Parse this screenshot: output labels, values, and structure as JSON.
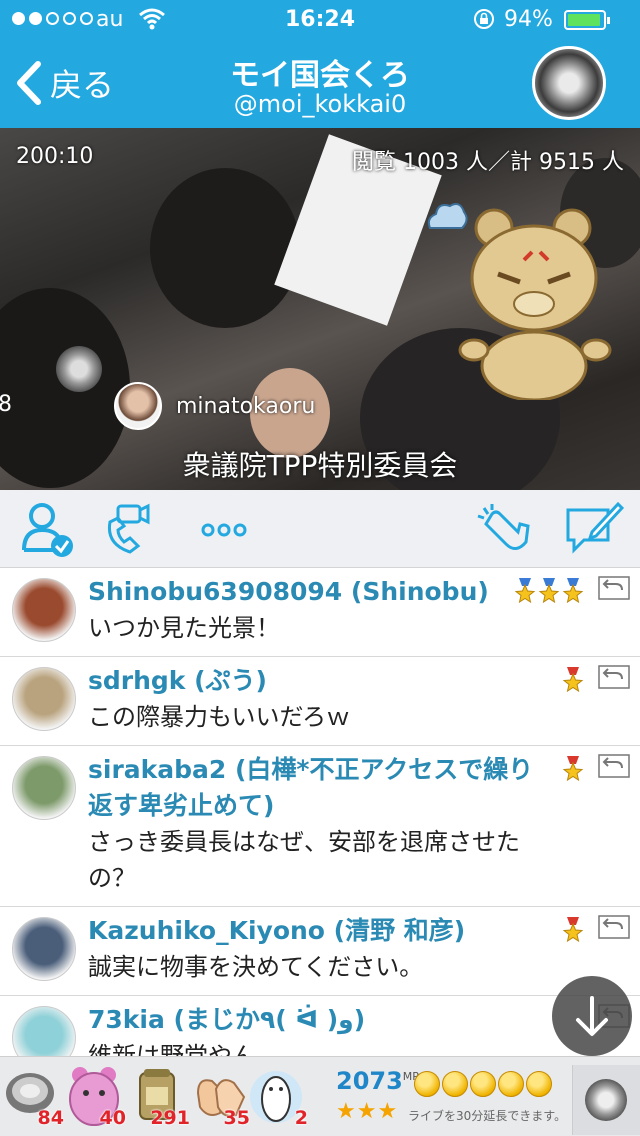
{
  "status_bar": {
    "carrier": "au",
    "time": "16:24",
    "battery": "94%",
    "battery_level": 0.94
  },
  "nav": {
    "back_label": "戻る",
    "title": "モイ国会くろ",
    "subtitle": "@moi_kokkai0"
  },
  "video": {
    "timer": "200:10",
    "views": "閲覧 1003 人／計 9515 人",
    "edge_number": "8",
    "commenter": "minatokaoru",
    "caption": "衆議院TPP特別委員会"
  },
  "comments": [
    {
      "name": "Shinobu63908094 (Shinobu)",
      "text": "いつか見た光景！",
      "stars": 3,
      "avatar_color": "#9a4a2e"
    },
    {
      "name": "sdrhgk (ぷう)",
      "text": "この際暴力もいいだろｗ",
      "stars": 1,
      "avatar_color": "#b9a37e"
    },
    {
      "name": "sirakaba2 (白樺*不正アクセスで繰り返す卑劣止めて)",
      "text": "さっき委員長はなぜ、安部を退席させたの？",
      "stars": 1,
      "avatar_color": "#7d9a6a"
    },
    {
      "name": "Kazuhiko_Kiyono (清野 和彦)",
      "text": "誠実に物事を決めてください。",
      "stars": 1,
      "avatar_color": "#4a5e7a"
    },
    {
      "name": "73kia (まじか٩( ᐛ )و)",
      "text": "維新は野党やん",
      "stars": 0,
      "avatar_color": "#8fd1d8"
    }
  ],
  "gifts": [
    {
      "icon": "coin-icon",
      "count": "84"
    },
    {
      "icon": "bear-icon",
      "count": "40"
    },
    {
      "icon": "tea-icon",
      "count": "291"
    },
    {
      "icon": "clap-icon",
      "count": "35"
    },
    {
      "icon": "penguin-icon",
      "count": "2"
    }
  ],
  "points": {
    "value": "2073",
    "unit": "MP",
    "stars": "★★★",
    "extend_text": "ライブを30分延長できます。"
  },
  "colors": {
    "accent": "#23a8e0",
    "name_blue": "#2a8ab4",
    "gift_count_red": "#e0242a"
  }
}
